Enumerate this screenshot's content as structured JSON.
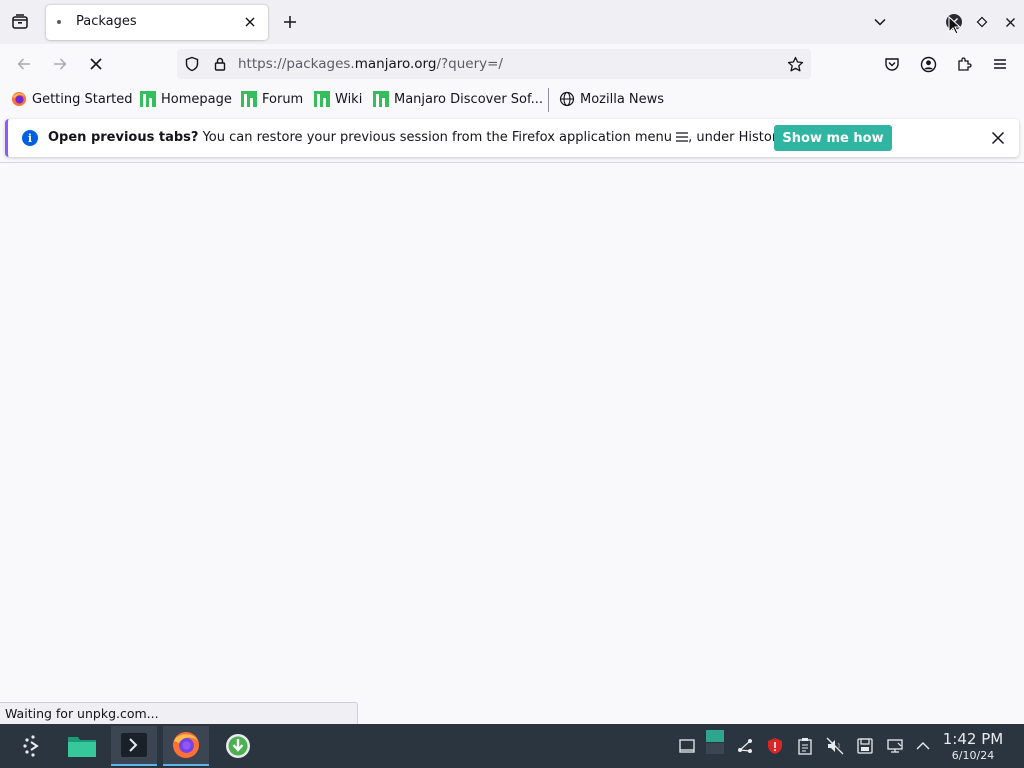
{
  "tabs": [
    {
      "title": "Packages",
      "loading": true
    }
  ],
  "navigation": {
    "url_prefix": "https://packages.",
    "url_host": "manjaro.org",
    "url_path": "/?query=/"
  },
  "bookmarks": [
    {
      "label": "Getting Started",
      "icon": "firefox-icon"
    },
    {
      "label": "Homepage",
      "icon": "manjaro-icon"
    },
    {
      "label": "Forum",
      "icon": "manjaro-icon"
    },
    {
      "label": "Wiki",
      "icon": "manjaro-icon"
    },
    {
      "label": "Manjaro Discover Sof...",
      "icon": "manjaro-icon"
    },
    {
      "label": "Mozilla News",
      "icon": "globe-icon"
    }
  ],
  "notification": {
    "title": "Open previous tabs?",
    "message_start": "You can restore your previous session from the Firefox application menu",
    "message_end": ", under History.",
    "button_label": "Show me how"
  },
  "status_text": "Waiting for unpkg.com...",
  "taskbar": {
    "apps": [
      "launcher-icon",
      "file-manager-icon",
      "terminal-icon",
      "firefox-icon",
      "update-manager-icon"
    ],
    "time": "1:42 PM",
    "date": "6/10/24"
  },
  "colors": {
    "accent_button": "#2fb5a2",
    "info_icon": "#0060df",
    "manjaro_green": "#35bf5c",
    "taskbar_bg": "#2b3540"
  }
}
